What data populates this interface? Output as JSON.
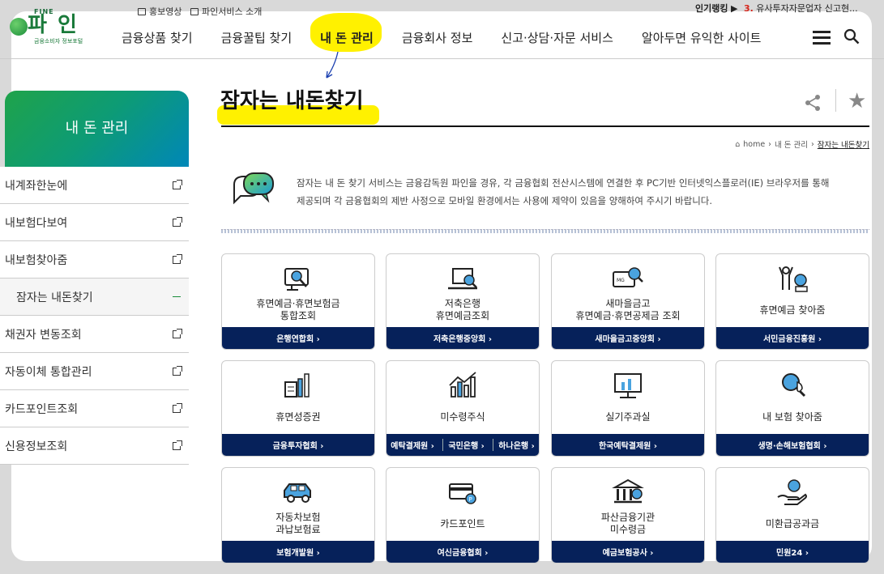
{
  "logo": {
    "top": "FINE",
    "name": "파 인",
    "sub": "금융소비자 정보포털"
  },
  "utility": {
    "promo_video": "홍보영상",
    "service_intro": "파인서비스 소개",
    "rank_label": "인기랭킹",
    "rank_num": "3.",
    "rank_text": "유사투자자문업자 신고현..."
  },
  "gnb": {
    "items": [
      "금융상품 찾기",
      "금융꿀팁 찾기",
      "내 돈 관리",
      "금융회사 정보",
      "신고·상담·자문 서비스",
      "알아두면 유익한 사이트"
    ],
    "active_index": 2
  },
  "sidebar": {
    "title": "내 돈 관리",
    "items": [
      {
        "label": "내계좌한눈에"
      },
      {
        "label": "내보험다보여"
      },
      {
        "label": "내보험찾아줌"
      },
      {
        "label": "잠자는 내돈찾기"
      },
      {
        "label": "채권자 변동조회"
      },
      {
        "label": "자동이체 통합관리"
      },
      {
        "label": "카드포인트조회"
      },
      {
        "label": "신용정보조회"
      }
    ],
    "active_index": 3
  },
  "page": {
    "title": "잠자는 내돈찾기",
    "breadcrumb": [
      "home",
      "내 돈 관리",
      "잠자는 내돈찾기"
    ],
    "intro_line1": "잠자는 내 돈 찾기 서비스는 금융감독원 파인을 경유, 각 금융협회 전산시스템에 연결한 후 PC기반 인터넷익스플로러(IE) 브라우저를 통해",
    "intro_line2": "제공되며 각 금융협회의 제반 사정으로 모바일 환경에서는 사용에 제약이 있음을 양해하여 주시기 바랍니다."
  },
  "cards": [
    {
      "title1": "휴면예금·휴면보험금",
      "title2": "통합조회",
      "buttons": [
        "은행연합회 ›"
      ],
      "icon": "monitor-search-icon"
    },
    {
      "title1": "저축은행",
      "title2": "휴면예금조회",
      "buttons": [
        "저축은행중앙회 ›"
      ],
      "icon": "laptop-search-icon"
    },
    {
      "title1": "새마을금고",
      "title2": "휴면예금·휴면공제금 조회",
      "buttons": [
        "새마을금고중앙회 ›"
      ],
      "icon": "card-search-icon"
    },
    {
      "title1": "휴면예금 찾아줌",
      "title2": "",
      "buttons": [
        "서민금융진흥원 ›"
      ],
      "icon": "people-coin-icon"
    },
    {
      "title1": "휴면성증권",
      "title2": "",
      "buttons": [
        "금융투자협회 ›"
      ],
      "icon": "document-chart-icon"
    },
    {
      "title1": "미수령주식",
      "title2": "",
      "buttons": [
        "예탁결제원 ›",
        "국민은행 ›",
        "하나은행 ›"
      ],
      "icon": "bar-chart-icon"
    },
    {
      "title1": "실기주과실",
      "title2": "",
      "buttons": [
        "한국예탁결제원 ›"
      ],
      "icon": "board-chart-icon"
    },
    {
      "title1": "내 보험 찾아줌",
      "title2": "",
      "buttons": [
        "생명·손해보험협회 ›"
      ],
      "icon": "insurance-search-icon"
    },
    {
      "title1": "자동차보험",
      "title2": "과납보험료",
      "buttons": [
        "보험개발원 ›"
      ],
      "icon": "car-icon"
    },
    {
      "title1": "카드포인트",
      "title2": "",
      "buttons": [
        "여신금융협회 ›"
      ],
      "icon": "credit-card-icon"
    },
    {
      "title1": "파산금융기관",
      "title2": "미수령금",
      "buttons": [
        "예금보험공사 ›"
      ],
      "icon": "bank-icon"
    },
    {
      "title1": "미환급공과금",
      "title2": "",
      "buttons": [
        "민원24 ›"
      ],
      "icon": "hand-coin-icon"
    }
  ]
}
